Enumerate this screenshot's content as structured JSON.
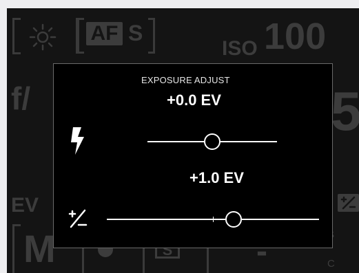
{
  "background": {
    "af_label": "AF",
    "af_mode": "S",
    "iso_label": "ISO",
    "iso_value": "100",
    "aperture_prefix": "f/",
    "shutter_fragment": "5",
    "ev_label": "EV",
    "mode_label": "M",
    "drive_label": "S",
    "side_s": "S",
    "side_c": "C",
    "dash": "-"
  },
  "dialog": {
    "title": "EXPOSURE ADJUST",
    "flash": {
      "icon": "flash-icon",
      "value": "+0.0 EV",
      "level": 0.0
    },
    "exposure": {
      "icon": "exposure-compensation-icon",
      "value": "+1.0 EV",
      "level": 1.0
    }
  },
  "colors": {
    "screen": "#141414",
    "dim_text": "#3c3c3c",
    "dialog_bg": "#000000",
    "foreground": "#ffffff"
  }
}
